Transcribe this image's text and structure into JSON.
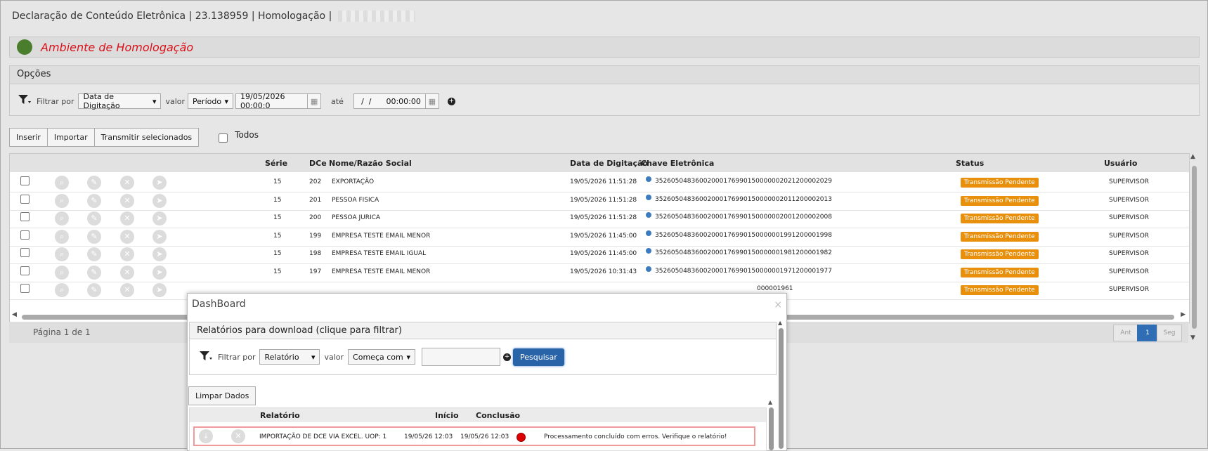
{
  "title": {
    "text": "Declaração de Conteúdo Eletrônica | 23.138959 | Homologação |"
  },
  "env": {
    "label": "Ambiente de Homologação",
    "color": "#4a7d2c"
  },
  "options": {
    "header": "Opções",
    "filter_label": "Filtrar por",
    "filter_value": "Data de Digitação",
    "value_label": "valor",
    "value_value": "Período",
    "date_from": "19/05/2026 00:00:0",
    "ate_label": "até",
    "date_to": "  /  /      00:00:00"
  },
  "toolbar": {
    "insert": "Inserir",
    "import": "Importar",
    "transmit": "Transmitir selecionados",
    "all": "Todos"
  },
  "grid": {
    "headers": {
      "serie": "Série",
      "dce": "DCe",
      "nome": "Nome/Razão Social",
      "data": "Data de Digitação",
      "chave": "Chave Eletrônica",
      "status": "Status",
      "usuario": "Usuário"
    },
    "rows": [
      {
        "serie": "15",
        "dce": "202",
        "nome": "EXPORTAÇÃO",
        "data": "19/05/2026 11:51:28",
        "chave": "35260504836002000176990150000002021200002029",
        "status": "Transmissão Pendente",
        "usuario": "SUPERVISOR"
      },
      {
        "serie": "15",
        "dce": "201",
        "nome": "PESSOA FISICA",
        "data": "19/05/2026 11:51:28",
        "chave": "35260504836002000176990150000002011200002013",
        "status": "Transmissão Pendente",
        "usuario": "SUPERVISOR"
      },
      {
        "serie": "15",
        "dce": "200",
        "nome": "PESSOA JURICA",
        "data": "19/05/2026 11:51:28",
        "chave": "35260504836002000176990150000002001200002008",
        "status": "Transmissão Pendente",
        "usuario": "SUPERVISOR"
      },
      {
        "serie": "15",
        "dce": "199",
        "nome": "EMPRESA TESTE EMAIL MENOR",
        "data": "19/05/2026 11:45:00",
        "chave": "35260504836002000176990150000001991200001998",
        "status": "Transmissão Pendente",
        "usuario": "SUPERVISOR"
      },
      {
        "serie": "15",
        "dce": "198",
        "nome": "EMPRESA TESTE EMAIL IGUAL",
        "data": "19/05/2026 11:45:00",
        "chave": "35260504836002000176990150000001981200001982",
        "status": "Transmissão Pendente",
        "usuario": "SUPERVISOR"
      },
      {
        "serie": "15",
        "dce": "197",
        "nome": "EMPRESA TESTE EMAIL MENOR",
        "data": "19/05/2026 10:31:43",
        "chave": "35260504836002000176990150000001971200001977",
        "status": "Transmissão Pendente",
        "usuario": "SUPERVISOR"
      },
      {
        "serie": "",
        "dce": "",
        "nome": "",
        "data": "",
        "chave": "000001961",
        "status": "Transmissão Pendente",
        "usuario": "SUPERVISOR"
      }
    ],
    "status_color": "#e8900c"
  },
  "pagination": {
    "label": "Página 1 de 1",
    "prev": "Ant",
    "current": "1",
    "next": "Seg"
  },
  "modal": {
    "title": "DashBoard",
    "reports_header": "Relatórios para download (clique para filtrar)",
    "filter_label": "Filtrar por",
    "filter_value": "Relatório",
    "value_label": "valor",
    "value_value": "Começa com",
    "search_button": "Pesquisar",
    "clear_button": "Limpar Dados",
    "headers": {
      "relatorio": "Relatório",
      "inicio": "Início",
      "conclusao": "Conclusão"
    },
    "row": {
      "relatorio": "IMPORTAÇÃO DE DCE VIA EXCEL. UOP: 1",
      "inicio": "19/05/26 12:03",
      "conclusao": "19/05/26 12:03",
      "mensagem": "Processamento concluído com erros. Verifique o relatório!"
    }
  }
}
